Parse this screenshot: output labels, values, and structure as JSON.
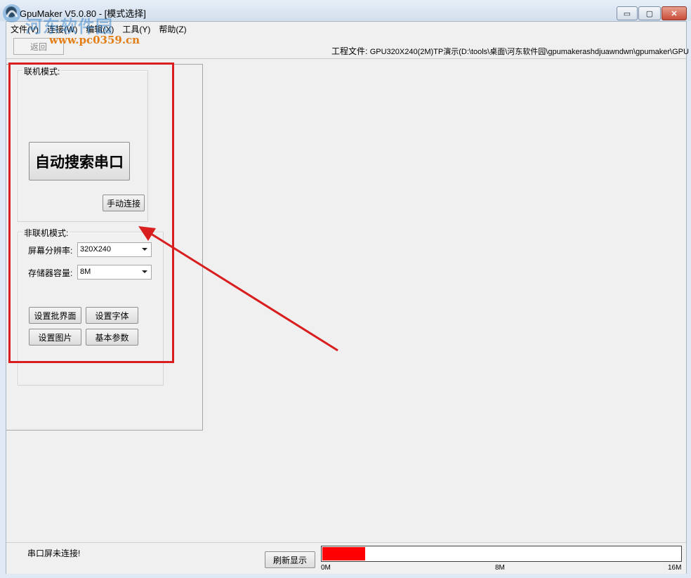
{
  "window": {
    "title": "GpuMaker V5.0.80 - [模式选择]",
    "controls": {
      "minimize": "▭",
      "maximize": "▢",
      "close": "✕"
    }
  },
  "menu": [
    "文件(V)",
    "连接(W)",
    "编辑(X)",
    "工具(Y)",
    "帮助(Z)"
  ],
  "toolbar": {
    "back_label": "返回",
    "project_label": "工程文件:",
    "project_path": "GPU320X240(2M)TP演示(D:\\tools\\桌面\\河东软件园\\gpumakerashdjuawndwn\\gpumaker\\GPU"
  },
  "online": {
    "group_title": "联机模式:",
    "auto_search_label": "自动搜索串口",
    "manual_connect_label": "手动连接"
  },
  "offline": {
    "group_title": "非联机模式:",
    "resolution_label": "屏幕分辨率:",
    "resolution_value": "320X240",
    "storage_label": "存储器容量:",
    "storage_value": "8M",
    "buttons": [
      "设置批界面",
      "设置字体",
      "设置图片",
      "基本参数"
    ]
  },
  "status": {
    "text": "串口屏未连接!",
    "refresh_label": "刷新显示",
    "progress_fraction": 0.12,
    "progress_color": "#ff0000",
    "ticks": [
      "0M",
      "8M",
      "16M"
    ]
  },
  "watermark": {
    "site_name": "河东软件园",
    "url": "www.pc0359.cn"
  },
  "annotation": {
    "color": "#d81e1e"
  }
}
